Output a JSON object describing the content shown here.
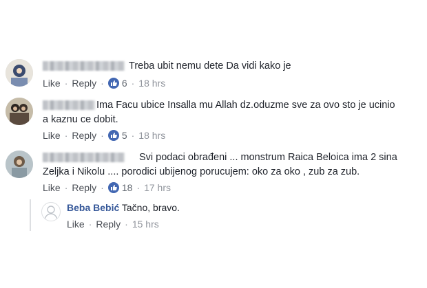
{
  "actions": {
    "like": "Like",
    "reply": "Reply",
    "separator": "·"
  },
  "comments": [
    {
      "text_lines": [
        "Treba ubit nemu dete Da vidi kako je"
      ],
      "reactions_count": "6",
      "time": "18 hrs"
    },
    {
      "text_lines": [
        "Ima Facu ubice Insalla mu Allah dz.oduzme sve za ovo sto je ucinio",
        "a kaznu ce dobit."
      ],
      "reactions_count": "5",
      "time": "18 hrs"
    },
    {
      "text_lines": [
        "Svi podaci obrađeni ... monstrum Raica Beloica ima 2 sina",
        "Zeljka i Nikolu .... porodici ubijenog porucujem: oko za oko , zub za zub."
      ],
      "reactions_count": "18",
      "time": "17 hrs"
    }
  ],
  "reply": {
    "author": "Beba Bebić",
    "text": "Tačno, bravo.",
    "time": "15 hrs"
  },
  "colors": {
    "link": "#365899",
    "like_blue": "#4267b2",
    "meta_gray": "#90949c"
  },
  "icons": [
    "like-thumb-icon",
    "default-avatar-icon"
  ]
}
